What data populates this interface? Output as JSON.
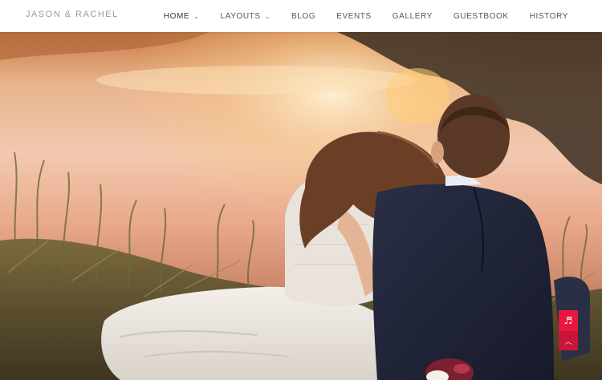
{
  "brand": {
    "name": "JASON & RACHEL"
  },
  "nav": {
    "items": [
      {
        "label": "HOME",
        "dropdown": true,
        "active": true
      },
      {
        "label": "LAYOUTS",
        "dropdown": true,
        "active": false
      },
      {
        "label": "BLOG",
        "dropdown": false,
        "active": false
      },
      {
        "label": "EVENTS",
        "dropdown": false,
        "active": false
      },
      {
        "label": "GALLERY",
        "dropdown": false,
        "active": false
      },
      {
        "label": "GUESTBOOK",
        "dropdown": false,
        "active": false
      },
      {
        "label": "HISTORY",
        "dropdown": false,
        "active": false
      }
    ],
    "caret_glyph": "⌄"
  },
  "floating": {
    "music_icon": "music-note-icon",
    "music_glyph": "♬",
    "top_icon": "chevron-up-icon",
    "top_glyph": "︿"
  },
  "colors": {
    "accent": "#e8173f",
    "accent_dark": "#c91538",
    "brand_text": "#9a9a9a",
    "nav_text": "#555555"
  }
}
